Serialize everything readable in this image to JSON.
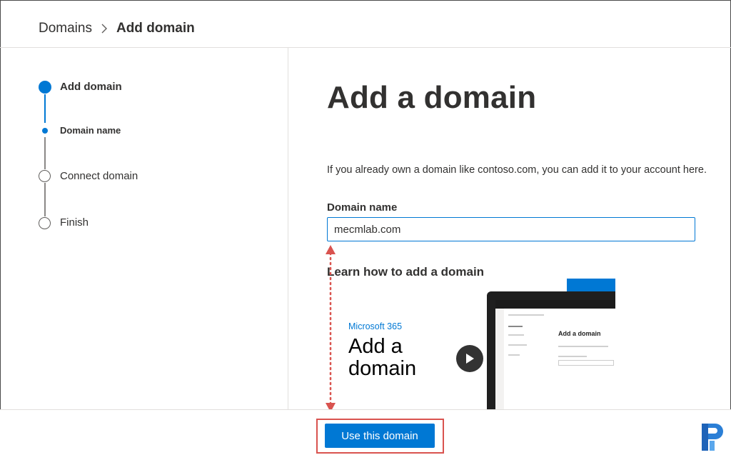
{
  "breadcrumb": {
    "parent": "Domains",
    "current": "Add domain",
    "separator_icon": "chevron-right-icon"
  },
  "steps": [
    {
      "label": "Add domain",
      "state": "current"
    },
    {
      "label": "Domain name",
      "state": "current-substep"
    },
    {
      "label": "Connect domain",
      "state": "pending"
    },
    {
      "label": "Finish",
      "state": "pending"
    }
  ],
  "main": {
    "title": "Add a domain",
    "description": "If you already own a domain like contoso.com, you can add it to your account here.",
    "field_label": "Domain name",
    "domain_value": "mecmlab.com",
    "learn_heading": "Learn how to add a domain",
    "video": {
      "brand": "Microsoft 365",
      "title": "Add a domain",
      "screen_title": "Add a domain",
      "play_icon": "play-icon"
    }
  },
  "footer": {
    "primary_button": "Use this domain"
  },
  "colors": {
    "accent": "#0078d4",
    "highlight": "#d9534f"
  }
}
